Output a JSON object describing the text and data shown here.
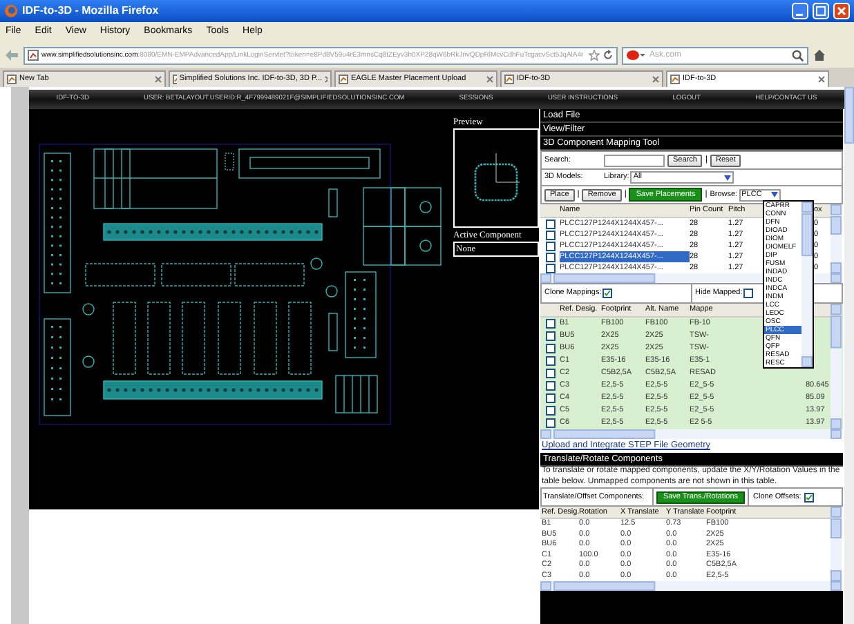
{
  "window": {
    "title": "IDF-to-3D - Mozilla Firefox"
  },
  "menu": [
    "File",
    "Edit",
    "View",
    "History",
    "Bookmarks",
    "Tools",
    "Help"
  ],
  "address_bar": {
    "domain": "www.simplifiedsolutionsinc.com",
    "path": ":8080/EMN-EMPAdvancedApp/LinkLoginServlet?token=e8Pd8V59u4rE3mnsCq8tZEyv3h0XP28qW6bRkJnvQDpRlMcvCdhFuTcgacvSct5JqAlA4r"
  },
  "search_bar": {
    "placeholder": "Ask.com"
  },
  "tabs": [
    {
      "label": "New Tab",
      "selected": false
    },
    {
      "label": "Simplified Solutions Inc. IDF-to-3D, 3D P...",
      "selected": false
    },
    {
      "label": "EAGLE Master Placement Upload",
      "selected": false
    },
    {
      "label": "IDF-to-3D",
      "selected": false
    },
    {
      "label": "IDF-to-3D",
      "selected": true
    }
  ],
  "site_nav": [
    "IDF-TO-3D",
    "USER: BETALAYOUT.USERID:R_4F7999489021F@SIMPLIFIEDSOLUTIONSINC.COM",
    "SESSIONS",
    "USER INSTRUCTIONS",
    "LOGOUT",
    "HELP/CONTACT US"
  ],
  "canvas": {
    "preview_label": "Preview",
    "active_component_label": "Active Component",
    "active_component": "None"
  },
  "panel": {
    "sections": [
      "Load File",
      "View/Filter",
      "3D Component Mapping Tool"
    ],
    "search_label": "Search:",
    "search_button": "Search",
    "separator": "|",
    "reset_button": "Reset",
    "models_label": "3D Models:",
    "library_label": "Library:",
    "library_value": "All",
    "actions": [
      {
        "kind": "button",
        "label": "Place"
      },
      {
        "kind": "separator",
        "label": "|"
      },
      {
        "kind": "button",
        "label": "Remove"
      },
      {
        "kind": "separator",
        "label": "|"
      },
      {
        "kind": "primary",
        "label": "Save Placements"
      },
      {
        "kind": "separator",
        "label": "|"
      },
      {
        "kind": "label",
        "label": "Browse:"
      }
    ],
    "browse_value": "PLCC",
    "browse_options": [
      {
        "label": "CAPRR",
        "selected": false
      },
      {
        "label": "CONN",
        "selected": false
      },
      {
        "label": "DFN",
        "selected": false
      },
      {
        "label": "DIOAD",
        "selected": false
      },
      {
        "label": "DIOM",
        "selected": false
      },
      {
        "label": "DIOMELF",
        "selected": false
      },
      {
        "label": "DIP",
        "selected": false
      },
      {
        "label": "FUSM",
        "selected": false
      },
      {
        "label": "INDAD",
        "selected": false
      },
      {
        "label": "INDC",
        "selected": false
      },
      {
        "label": "INDCA",
        "selected": false
      },
      {
        "label": "INDM",
        "selected": false
      },
      {
        "label": "LCC",
        "selected": false
      },
      {
        "label": "LEDC",
        "selected": false
      },
      {
        "label": "OSC",
        "selected": false
      },
      {
        "label": "PLCC",
        "selected": true
      },
      {
        "label": "QFN",
        "selected": false
      },
      {
        "label": "QFP",
        "selected": false
      },
      {
        "label": "RESAD",
        "selected": false
      },
      {
        "label": "RESC",
        "selected": false
      }
    ],
    "models_table": {
      "columns": [
        "Name",
        "Pin Count",
        "Pitch",
        "ox"
      ],
      "rows": [
        {
          "checked": false,
          "selected": false,
          "cells": [
            "PLCC127P1244X1244X457-...",
            "28",
            "1.27",
            "0"
          ]
        },
        {
          "checked": false,
          "selected": false,
          "cells": [
            "PLCC127P1244X1244X457-...",
            "28",
            "1.27",
            "0"
          ]
        },
        {
          "checked": false,
          "selected": false,
          "cells": [
            "PLCC127P1244X1244X457-...",
            "28",
            "1.27",
            "0"
          ]
        },
        {
          "checked": false,
          "selected": true,
          "cells": [
            "PLCC127P1244X1244X457-...",
            "28",
            "1.27",
            "0"
          ]
        },
        {
          "checked": false,
          "selected": false,
          "cells": [
            "PLCC127P1244X1244X457-...",
            "28",
            "1.27",
            "0"
          ]
        }
      ]
    },
    "clone_mappings": {
      "label": "Clone Mappings:",
      "checked": true
    },
    "hide_mapped": {
      "label": "Hide Mapped:",
      "checked": false
    },
    "mapping_table": {
      "columns": [
        "Ref. Desig.",
        "Footprint",
        "Alt. Name",
        "Mappe"
      ],
      "rows": [
        {
          "checked": false,
          "cells": [
            "B1",
            "FB100",
            "FB100",
            "FB-10"
          ]
        },
        {
          "checked": false,
          "cells": [
            "BU5",
            "2X25",
            "2X25",
            "TSW-"
          ]
        },
        {
          "checked": false,
          "cells": [
            "BU6",
            "2X25",
            "2X25",
            "TSW-"
          ]
        },
        {
          "checked": false,
          "cells": [
            "C1",
            "E35-16",
            "E35-16",
            "E35-1"
          ]
        },
        {
          "checked": false,
          "cells": [
            "C2",
            "C5B2,5A",
            "C5B2,5A",
            "RESAD"
          ]
        },
        {
          "checked": false,
          "cells": [
            "C3",
            "E2,5-5",
            "E2,5-5",
            "E2_5-5",
            "80.645"
          ]
        },
        {
          "checked": false,
          "cells": [
            "C4",
            "E2,5-5",
            "E2,5-5",
            "E2_5-5",
            "85.09"
          ]
        },
        {
          "checked": false,
          "cells": [
            "C5",
            "E2,5-5",
            "E2,5-5",
            "E2_5-5",
            "13.97"
          ]
        },
        {
          "checked": false,
          "cells": [
            "C6",
            "E2,5-5",
            "E2,5-5",
            "E2 5-5",
            "13.97"
          ]
        }
      ]
    },
    "upload_link": "Upload and Integrate STEP File Geometry",
    "translate_section": "Translate/Rotate Components",
    "translate_help": "To translate or rotate mapped components, update the X/Y/Rotation Values in the table below. Unmapped components are not shown in this table.",
    "translate_label": "Translate/Offset Components:",
    "save_button": "Save Trans./Rotations",
    "clone_offsets": {
      "label": "Clone Offsets:",
      "checked": true
    },
    "translate_table": {
      "columns": [
        "Ref. Desig.",
        "Rotation",
        "X Translate",
        "Y Translate",
        "Footprint"
      ],
      "rows": [
        [
          "B1",
          "0.0",
          "12.5",
          "0.73",
          "FB100"
        ],
        [
          "BU5",
          "0.0",
          "0.0",
          "0.0",
          "2X25"
        ],
        [
          "BU6",
          "0.0",
          "0.0",
          "0.0",
          "2X25"
        ],
        [
          "C1",
          "100.0",
          "0.0",
          "0.0",
          "E35-16"
        ],
        [
          "C2",
          "0.0",
          "0.0",
          "0.0",
          "C5B2,5A"
        ],
        [
          "C3",
          "0.0",
          "0.0",
          "0.0",
          "E2,5-5"
        ]
      ]
    }
  }
}
